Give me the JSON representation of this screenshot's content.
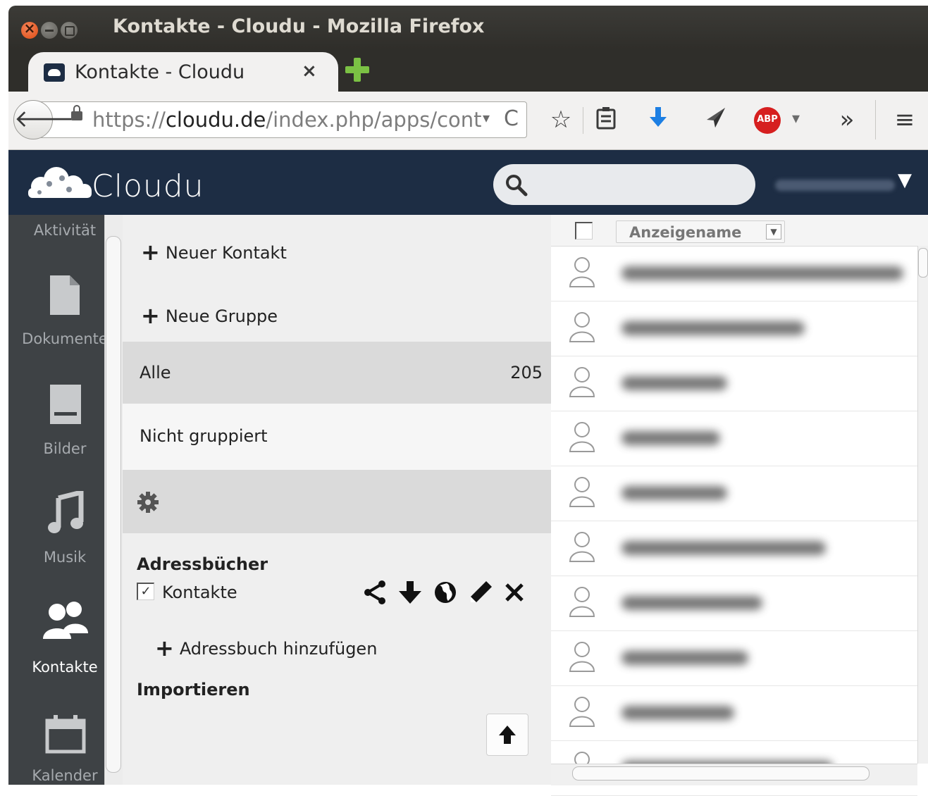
{
  "window": {
    "title": "Kontakte - Cloudu - Mozilla Firefox"
  },
  "tab": {
    "title": "Kontakte - Cloudu",
    "close": "×"
  },
  "navbar": {
    "url_scheme": "https://",
    "url_host": "cloudu.de",
    "url_path": "/index.php/apps/cont",
    "icons": [
      "back-icon",
      "lock-icon",
      "reload-icon",
      "star-icon",
      "reading-list-icon",
      "download-icon",
      "send-icon",
      "adblock-icon",
      "overflow-icon",
      "menu-icon"
    ],
    "back_glyph": "🡐",
    "star_glyph": "☆",
    "overflow_glyph": "»",
    "menu_glyph": "≡",
    "reload_glyph": "C",
    "abp_label": "ABP"
  },
  "app": {
    "name": "Cloudu",
    "logo_text": "Cloudu",
    "brand_color": "#1d2d44"
  },
  "appnav": {
    "items": [
      {
        "label": "Aktivität",
        "icon": "activity-icon",
        "active": false
      },
      {
        "label": "Dokumente",
        "icon": "document-icon",
        "active": false
      },
      {
        "label": "Bilder",
        "icon": "pictures-icon",
        "active": false
      },
      {
        "label": "Musik",
        "icon": "music-icon",
        "active": false
      },
      {
        "label": "Kontakte",
        "icon": "contacts-icon",
        "active": true
      },
      {
        "label": "Kalender",
        "icon": "calendar-icon",
        "active": false
      }
    ]
  },
  "groups": {
    "new_contact": "Neuer Kontakt",
    "new_group": "Neue Gruppe",
    "all": {
      "label": "Alle",
      "count": "205"
    },
    "ungrouped": "Nicht gruppiert",
    "settings_icon": "gear-icon",
    "addressbooks_heading": "Adressbücher",
    "addressbook": {
      "label": "Kontakte",
      "checked": true
    },
    "addressbook_actions": [
      "share-icon",
      "download-icon",
      "globe-icon",
      "edit-icon",
      "delete-icon"
    ],
    "add_addressbook": "Adressbuch hinzufügen",
    "import_heading": "Importieren",
    "upload_icon": "upload-icon"
  },
  "contacts": {
    "sort_label": "Anzeigename",
    "row_count_visible": 10
  }
}
